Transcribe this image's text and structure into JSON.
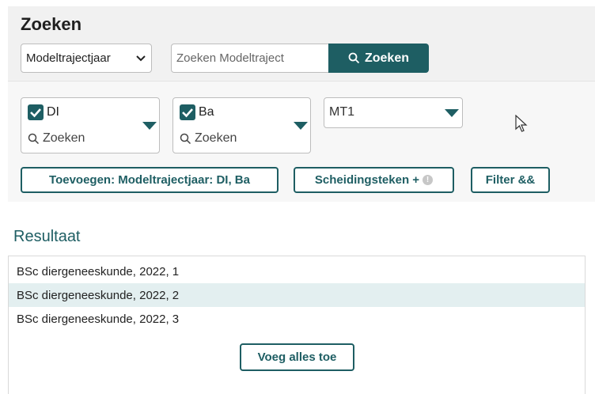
{
  "search": {
    "title": "Zoeken",
    "select_value": "Modeltrajectjaar",
    "input_placeholder": "Zoeken Modeltraject",
    "button_label": "Zoeken"
  },
  "filters": [
    {
      "label": "DI",
      "checked": true,
      "search_label": "Zoeken"
    },
    {
      "label": "Ba",
      "checked": true,
      "search_label": "Zoeken"
    },
    {
      "label": "MT1"
    }
  ],
  "actions": {
    "add_label": "Toevoegen: Modeltrajectjaar: DI, Ba",
    "separator_label": "Scheidingsteken +",
    "filter_label": "Filter &&"
  },
  "results": {
    "title": "Resultaat",
    "items": [
      "BSc diergeneeskunde, 2022, 1",
      "BSc diergeneeskunde, 2022, 2",
      "BSc diergeneeskunde, 2022, 3"
    ],
    "add_all_label": "Voeg alles toe"
  },
  "colors": {
    "accent": "#1e5e63",
    "highlight_row": "#e3eff0"
  }
}
